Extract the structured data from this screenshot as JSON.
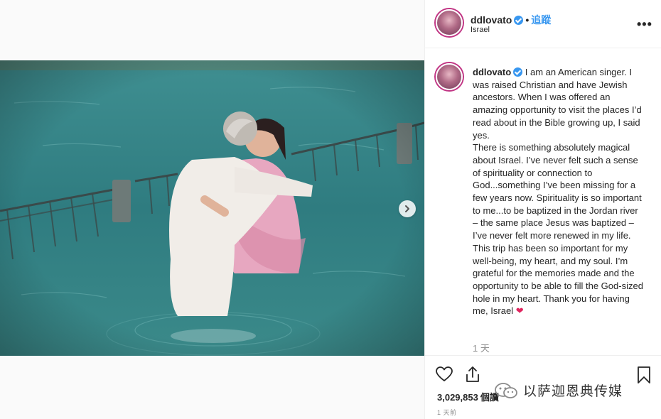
{
  "header": {
    "username": "ddlovato",
    "follow_separator": "•",
    "follow_label": "追蹤",
    "location": "Israel",
    "more_label": "•••"
  },
  "caption": {
    "username": "ddlovato",
    "text": " I am an American singer. I was raised Christian and have Jewish ancestors. When I was offered an amazing opportunity to visit the places I’d read about in the Bible growing up, I said yes.\nThere is something absolutely magical about Israel.  I’ve never felt such a sense of spirituality or connection to God...something I’ve been missing for a few years now.  Spirituality is so important to me...to be baptized in the Jordan river – the same place Jesus was baptized – I’ve never felt more renewed in my life.\nThis trip has been so important for my well-being, my heart, and my soul.  I’m grateful for the memories made and the opportunity to be able to fill the God-sized hole in my heart. Thank you for having me, Israel ",
    "emoji": "❤",
    "time": "1 天"
  },
  "actions": {
    "views_count": "3,029,853",
    "views_label": "個讀",
    "date": "1 天前"
  },
  "watermark": {
    "text": "以萨迦恩典传媒"
  },
  "icons": {
    "like": "heart-icon",
    "share": "share-icon",
    "save": "bookmark-icon",
    "next": "chevron-right-icon",
    "verified": "verified-badge-icon"
  },
  "colors": {
    "link_blue": "#3897f0",
    "text": "#262626",
    "muted": "#8e8e8e",
    "heart_red": "#e0245e"
  }
}
